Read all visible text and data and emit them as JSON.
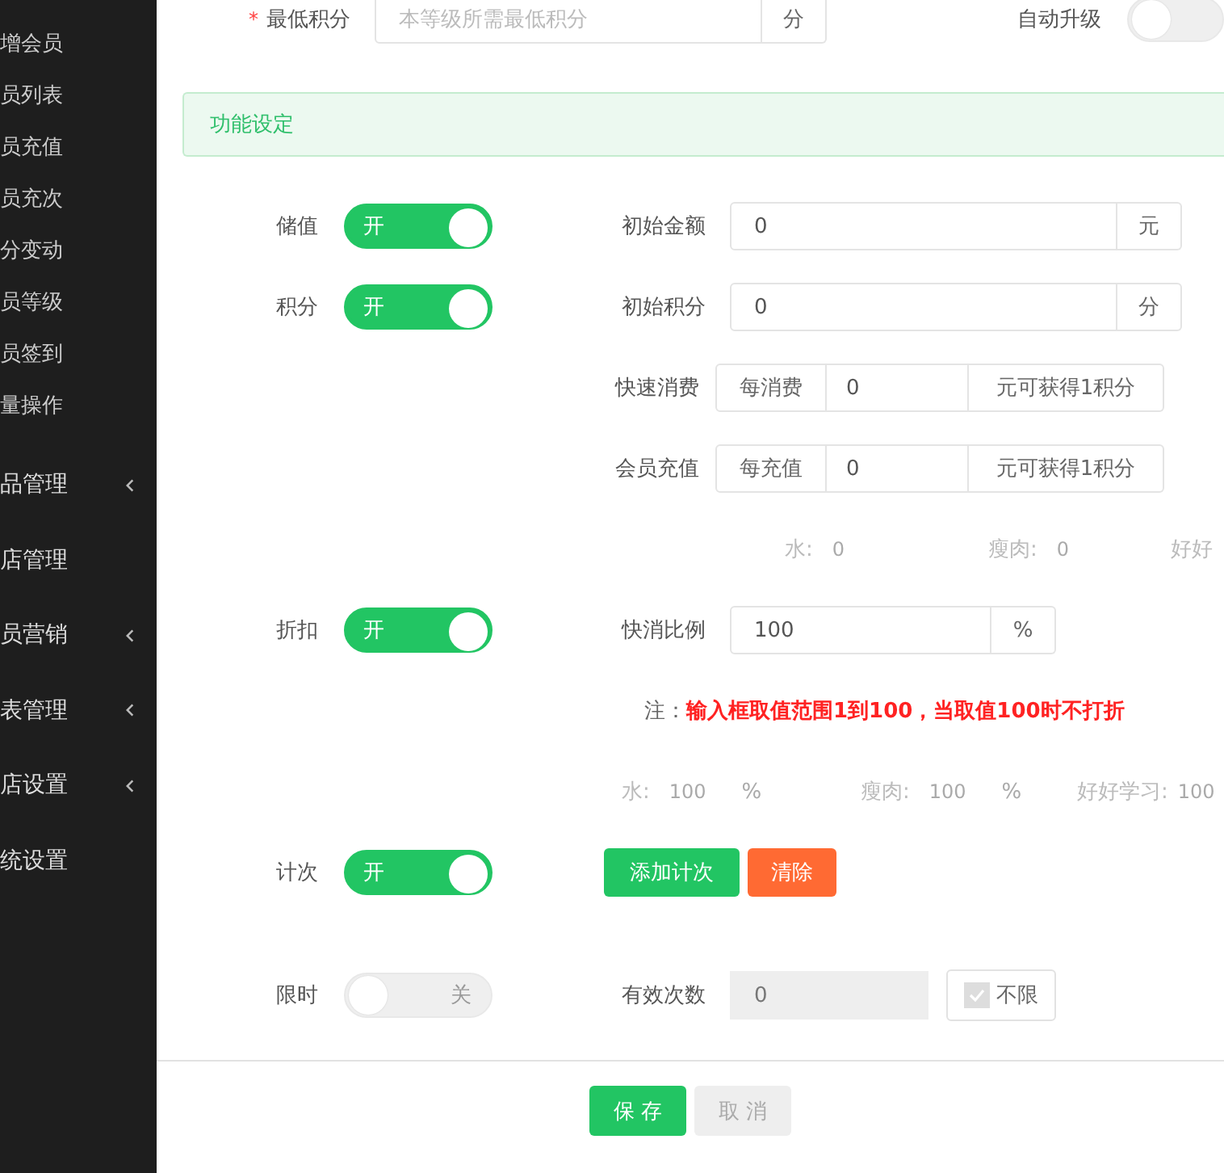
{
  "sidebar": {
    "sub_items": [
      {
        "label": "增会员"
      },
      {
        "label": "员列表"
      },
      {
        "label": "员充值"
      },
      {
        "label": "员充次"
      },
      {
        "label": "分变动"
      },
      {
        "label": "员等级"
      },
      {
        "label": "员签到"
      },
      {
        "label": "量操作"
      }
    ],
    "menu_items": [
      {
        "label": "品管理",
        "has_submenu": true
      },
      {
        "label": "店管理",
        "has_submenu": false
      },
      {
        "label": "员营销",
        "has_submenu": true
      },
      {
        "label": "表管理",
        "has_submenu": true
      },
      {
        "label": "店设置",
        "has_submenu": true
      },
      {
        "label": "统设置",
        "has_submenu": false
      }
    ]
  },
  "top_field": {
    "required_mark": "*",
    "label": "最低积分",
    "placeholder": "本等级所需最低积分",
    "unit": "分"
  },
  "auto_upgrade": {
    "label": "自动升级",
    "on": false
  },
  "section": {
    "title": "功能设定"
  },
  "rows": [
    {
      "kind": "feature",
      "label": "储值",
      "switch": {
        "on": true,
        "text": "开"
      },
      "field": {
        "label": "初始金额",
        "value": "0",
        "unit": "元"
      }
    },
    {
      "kind": "feature",
      "label": "积分",
      "switch": {
        "on": true,
        "text": "开"
      },
      "field": {
        "label": "初始积分",
        "value": "0",
        "unit": "分"
      }
    },
    {
      "kind": "rate",
      "label": "快速消费",
      "prefix": "每消费",
      "value": "0",
      "suffix": "元可获得1积分"
    },
    {
      "kind": "rate",
      "label": "会员充值",
      "prefix": "每充值",
      "value": "0",
      "suffix": "元可获得1积分"
    },
    {
      "kind": "levels",
      "items": [
        {
          "name": "水:",
          "value": "0"
        },
        {
          "name": "瘦肉:",
          "value": "0"
        },
        {
          "name": "好好"
        }
      ]
    },
    {
      "kind": "feature",
      "label": "折扣",
      "switch": {
        "on": true,
        "text": "开"
      },
      "field": {
        "label": "快消比例",
        "value": "100",
        "unit": "%"
      }
    },
    {
      "kind": "note",
      "text": "注：**输入框取值范围1到100，当取值100时不打折**"
    },
    {
      "kind": "levels_pct",
      "items": [
        {
          "name": "水:",
          "value": "100",
          "unit": "%"
        },
        {
          "name": "瘦肉:",
          "value": "100",
          "unit": "%"
        },
        {
          "name": "好好学习:",
          "value": "100"
        }
      ]
    },
    {
      "kind": "feature",
      "label": "计次",
      "switch": {
        "on": true,
        "text": "开"
      },
      "buttons": [
        {
          "label": "添加计次"
        },
        {
          "label": "清除"
        }
      ]
    },
    {
      "kind": "feature",
      "label": "限时",
      "switch": {
        "on": false,
        "text": "关"
      },
      "field": {
        "label": "有效次数",
        "value": "0",
        "disabled": true
      },
      "checkbox": {
        "label": "不限",
        "checked": true,
        "disabled": true
      }
    }
  ],
  "footer": {
    "buttons": [
      {
        "label": "保 存",
        "disabled": false
      },
      {
        "label": "取 消",
        "disabled": true
      }
    ]
  }
}
